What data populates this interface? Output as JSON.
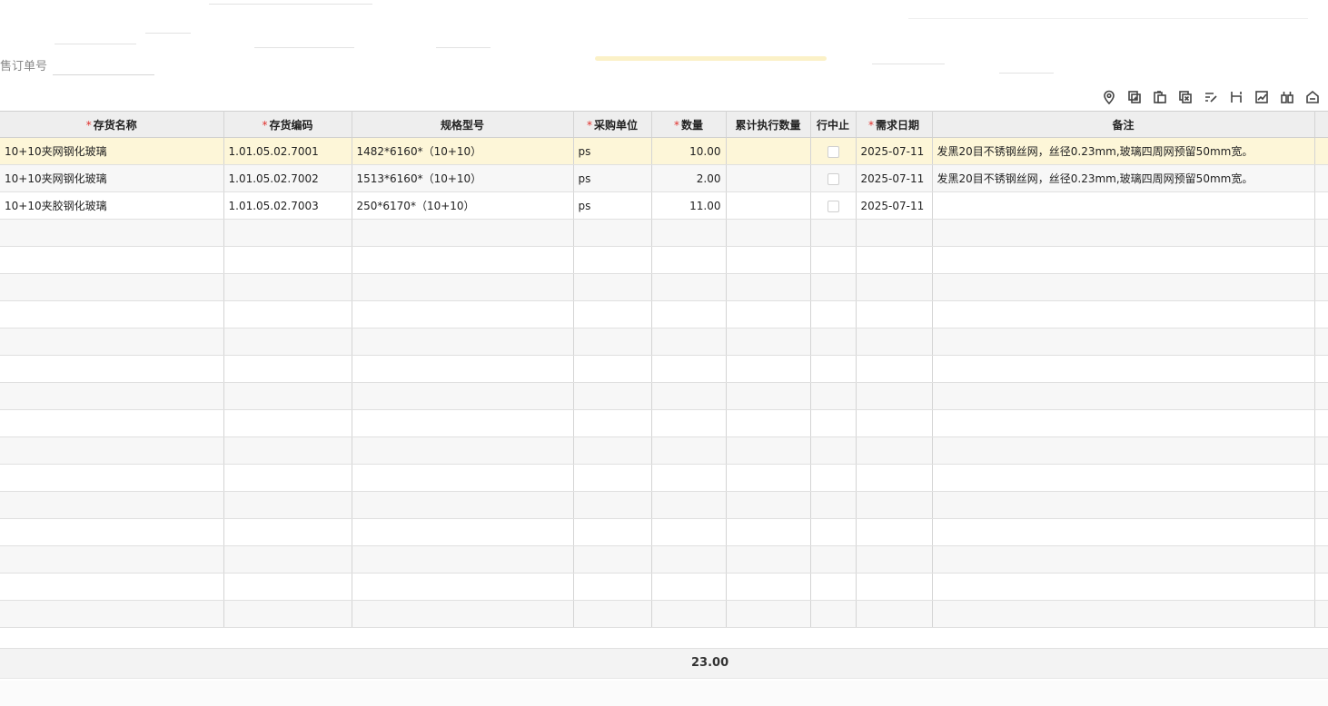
{
  "form": {
    "sales_order_label": "售订单号",
    "sales_order_value": ""
  },
  "toolbar": {
    "buttons": [
      "location-icon",
      "add-row-icon",
      "copy-row-icon",
      "delete-row-icon",
      "batch-edit-icon",
      "split-icon",
      "chart-icon",
      "grid-settings-icon",
      "home-icon"
    ]
  },
  "table": {
    "columns": [
      {
        "label": "存货名称",
        "required": true
      },
      {
        "label": "存货编码",
        "required": true
      },
      {
        "label": "规格型号",
        "required": false
      },
      {
        "label": "采购单位",
        "required": true
      },
      {
        "label": "数量",
        "required": true
      },
      {
        "label": "累计执行数量",
        "required": false
      },
      {
        "label": "行中止",
        "required": false
      },
      {
        "label": "需求日期",
        "required": true
      },
      {
        "label": "备注",
        "required": false
      }
    ],
    "rows": [
      {
        "name": "10+10夹网钢化玻璃",
        "code": "1.01.05.02.7001",
        "spec": "1482*6160*（10+10）",
        "unit": "ps",
        "qty": "10.00",
        "executed": "",
        "stopped": false,
        "date": "2025-07-11",
        "remark": "发黑20目不锈钢丝网，丝径0.23mm,玻璃四周网预留50mm宽。"
      },
      {
        "name": "10+10夹网钢化玻璃",
        "code": "1.01.05.02.7002",
        "spec": "1513*6160*（10+10）",
        "unit": "ps",
        "qty": "2.00",
        "executed": "",
        "stopped": false,
        "date": "2025-07-11",
        "remark": "发黑20目不锈钢丝网，丝径0.23mm,玻璃四周网预留50mm宽。"
      },
      {
        "name": "10+10夹胶钢化玻璃",
        "code": "1.01.05.02.7003",
        "spec": "250*6170*（10+10）",
        "unit": "ps",
        "qty": "11.00",
        "executed": "",
        "stopped": false,
        "date": "2025-07-11",
        "remark": ""
      }
    ],
    "empty_rows": 15,
    "selected_row": 0
  },
  "footer": {
    "qty_total": "23.00"
  },
  "colors": {
    "required_star": "#e0302c",
    "selected_row": "#fdf6d8",
    "header_bg": "#eeeeee"
  }
}
